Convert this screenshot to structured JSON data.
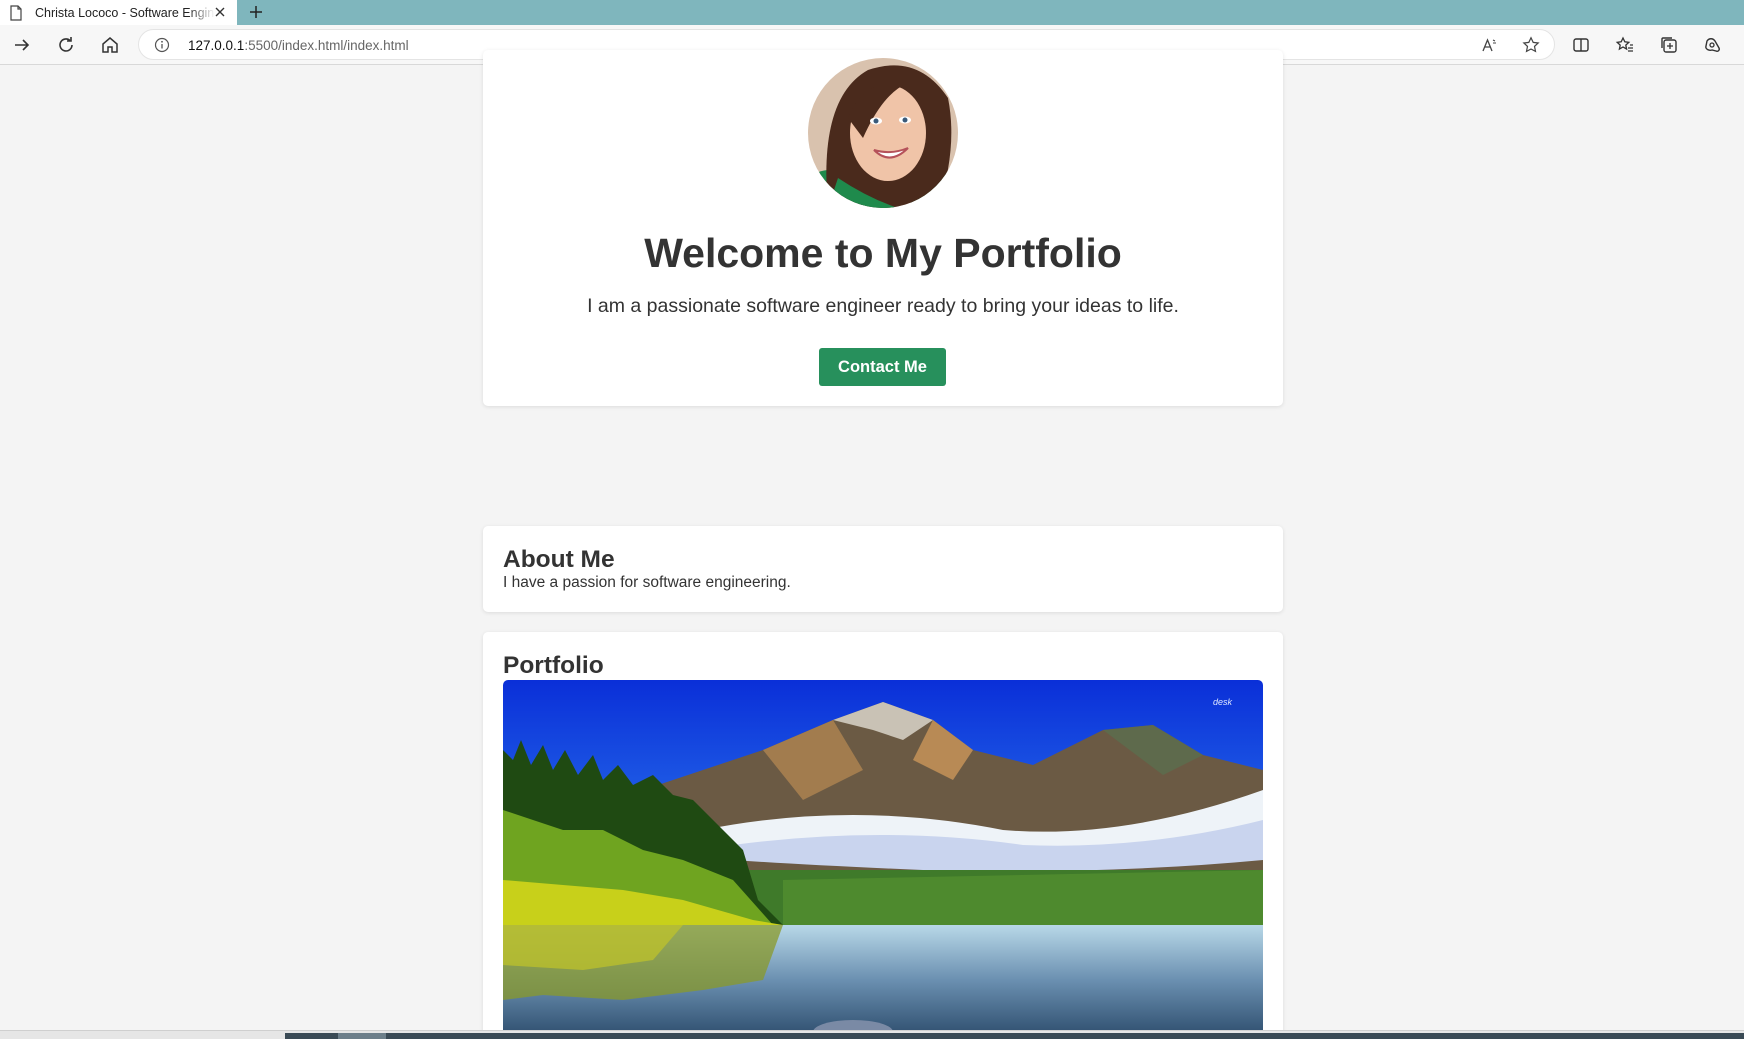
{
  "browser": {
    "tab_title": "Christa Lococo - Software Engineer",
    "address_host": "127.0.0.1",
    "address_path": ":5500/index.html/index.html",
    "icons": [
      "document-icon",
      "close-icon",
      "new-tab-icon",
      "forward-icon",
      "refresh-icon",
      "home-icon",
      "info-icon",
      "read-aloud-icon",
      "favorite-star-icon",
      "split-screen-icon",
      "favorites-icon",
      "collections-icon",
      "copilot-icon"
    ]
  },
  "hero": {
    "title": "Welcome to My Portfolio",
    "subtitle": "I am a passionate software engineer ready to bring your ideas to life.",
    "contact_label": "Contact Me",
    "button_color": "#27905c"
  },
  "about": {
    "heading": "About Me",
    "text": "I have a passion for software engineering."
  },
  "portfolio": {
    "heading": "Portfolio"
  },
  "colors": {
    "page_bg": "#f4f4f4",
    "tab_strip": "#7fb6bd",
    "text": "#333333"
  }
}
